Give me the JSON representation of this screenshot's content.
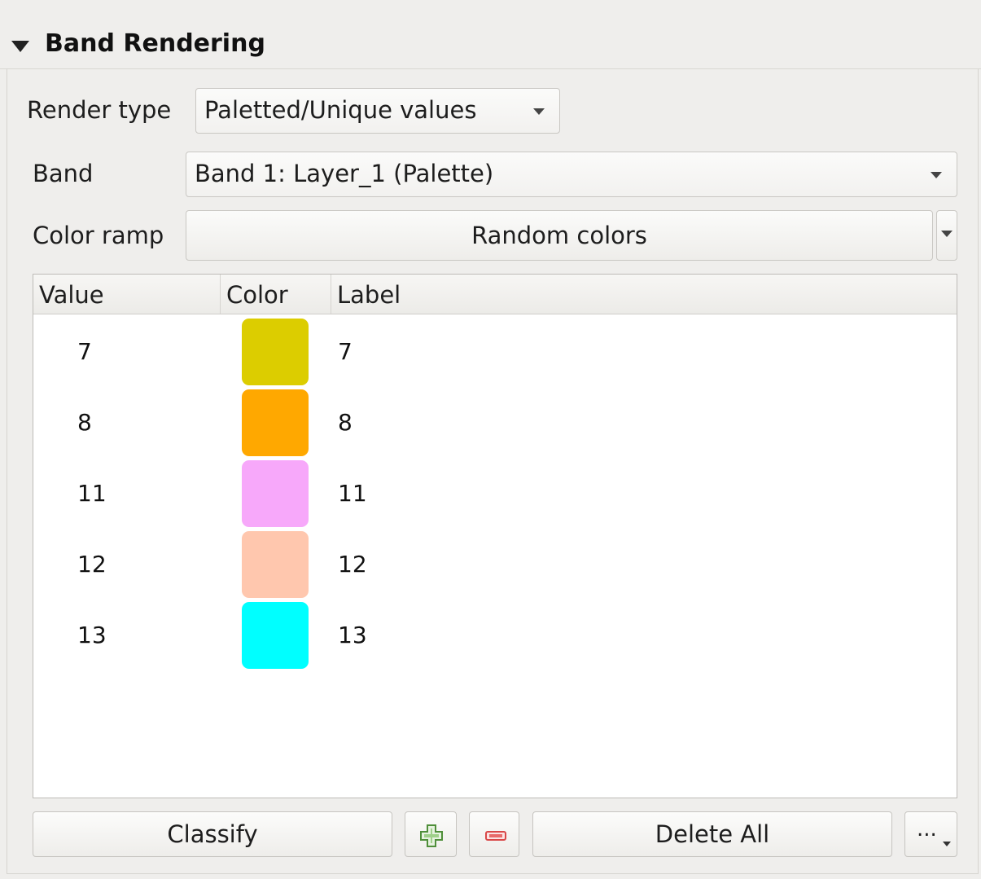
{
  "section": {
    "title": "Band Rendering"
  },
  "render_type": {
    "label": "Render type",
    "value": "Paletted/Unique values"
  },
  "band": {
    "label": "Band",
    "value": "Band 1: Layer_1 (Palette)"
  },
  "color_ramp": {
    "label": "Color ramp",
    "value": "Random colors"
  },
  "table": {
    "columns": [
      "Value",
      "Color",
      "Label"
    ],
    "rows": [
      {
        "value": "7",
        "color": "#dccd00",
        "label": "7"
      },
      {
        "value": "8",
        "color": "#ffa800",
        "label": "8"
      },
      {
        "value": "11",
        "color": "#f7a8fa",
        "label": "11"
      },
      {
        "value": "12",
        "color": "#ffc7ae",
        "label": "12"
      },
      {
        "value": "13",
        "color": "#00ffff",
        "label": "13"
      }
    ]
  },
  "buttons": {
    "classify": "Classify",
    "add_icon": "plus-icon",
    "remove_icon": "minus-icon",
    "delete_all": "Delete All",
    "more": "..."
  }
}
